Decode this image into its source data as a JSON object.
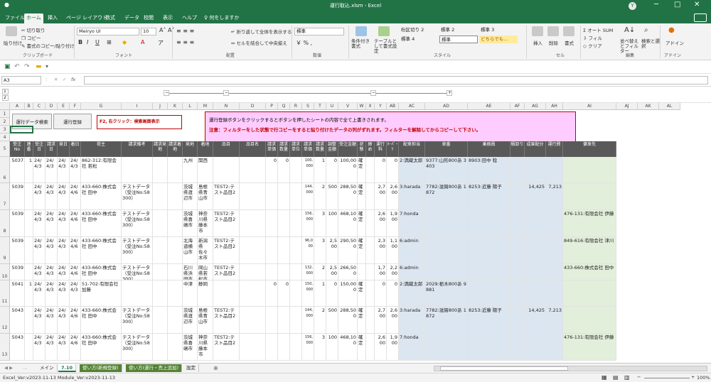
{
  "window": {
    "title": "運行取込.xlsm - Excel",
    "user_initial": "Y",
    "min": "─",
    "max": "□",
    "close": "✕"
  },
  "ribbon_tabs": [
    "ファイル",
    "ホーム",
    "挿入",
    "ページ レイアウト",
    "数式",
    "データ",
    "校閲",
    "表示",
    "ヘルプ",
    "何をしますか"
  ],
  "ribbon": {
    "paste": "貼り付け",
    "cut": "切り取り",
    "copy": "コピー",
    "format_painter": "書式のコピー/貼り付け",
    "clipboard_group": "クリップボード",
    "font_name": "Meiryo UI",
    "font_size": "10",
    "font_group": "フォント",
    "wrap_text": "折り返して全体を表示する",
    "merge_center": "セルを結合して中央揃え",
    "align_group": "配置",
    "number_format": "標準",
    "number_group": "数値",
    "cond_format": "条件付き書式",
    "table_format": "テーブルとして書式設定",
    "styles": [
      "桁区切り 2",
      "標準 2",
      "標準 3",
      "標準 4",
      "標準",
      "どちらでも..."
    ],
    "style_group": "スタイル",
    "insert": "挿入",
    "delete": "削除",
    "format": "書式",
    "cells_group": "セル",
    "autosum": "オート SUM",
    "fill": "フィル",
    "clear": "クリア",
    "sort_filter": "並べ替えとフィルター",
    "find_select": "検索と選択",
    "edit_group": "編集",
    "addin": "アドイン",
    "addin_group": "アドイン"
  },
  "formula_bar": {
    "name_box": "A3",
    "fx": "fx",
    "content": ""
  },
  "outline": {
    "levels": [
      "1",
      "2"
    ],
    "minus": "−",
    "plus": "+"
  },
  "columns": [
    "A",
    "B",
    "C",
    "D",
    "E",
    "F",
    "G",
    "I",
    "J",
    "K",
    "L",
    "M",
    "N",
    "O",
    "P",
    "Q",
    "R",
    "S",
    "T",
    "U",
    "V",
    "W",
    "X",
    "Y",
    "AB",
    "AC",
    "AD",
    "AE",
    "AF",
    "AG",
    "AH",
    "AI",
    "AJ",
    "AK",
    "AL"
  ],
  "rows": [
    "1",
    "2",
    "3",
    "4",
    "5",
    "6",
    "7",
    "8",
    "9",
    "10",
    "11",
    "12",
    "13"
  ],
  "top": {
    "btn_import": "運行データ検索",
    "btn_register": "運行登録",
    "hint_f2": "F2, 右クリック：検索画面表示",
    "note1": "運行登録ボタンをクリックするとボタンを押したシートの内容で全て上書きされます。",
    "note2": "注意：フィルターをした状態で行コピーをすると貼り付けたデータの列がずれます。フィルターを解除してからコピーして下さい。"
  },
  "headers": [
    "受注No",
    "連番",
    "受注日",
    "請求日",
    "発日",
    "着日",
    "荷主",
    "請求備考",
    "請求発地",
    "請求着地",
    "発地",
    "着地",
    "品目",
    "品目名",
    "請求単価",
    "請求数量",
    "請求単位",
    "請求単価",
    "請求数量",
    "調整金額",
    "受注金額",
    "状態",
    "締め",
    "運行料",
    "ｷｰﾊﾟｰﾂ",
    "配車担当",
    "車番",
    "乗務員",
    "積卸り",
    "成果配分",
    "運行費",
    "傭車先"
  ],
  "table_rows": [
    {
      "no": "5037",
      "ren": "1",
      "ju": "24/4/3",
      "sei": "24/4/3",
      "hatsu": "24/4/3",
      "chaku": "24/4/3",
      "ninushi": "862-312:有限会社 若松",
      "biko": "",
      "hatchi": "九州",
      "chakuchi": "関西",
      "hinmoku": "",
      "hinmei": "",
      "tan": "0",
      "su": "0",
      "tanka2": "100,000",
      "su2": "1",
      "cho": "0",
      "kin": "100,000",
      "jo": "確定",
      "shime": "",
      "ryo": "0",
      "kp": "0",
      "tanto": "2:満蔵太郎",
      "sha": "9377:山形800あ 3403",
      "jomu": "8903:田中 稔",
      "tsumi": "",
      "seika": "",
      "unko": "",
      "yosha": ""
    },
    {
      "no": "5039",
      "ren": "",
      "ju": "24/4/3",
      "sei": "24/4/3",
      "hatsu": "24/4/3",
      "chaku": "24/4/6",
      "ninushi": "433-660:株式会社 田中",
      "biko": "テストデータ（受注No:58300）",
      "hatchi": "茨城県渡辺市",
      "chakuchi": "島根県青山市",
      "hinmoku": "TEST2:テスト品目2",
      "hinmei": "",
      "tan": "",
      "su": "",
      "tanka2": "144,000",
      "su2": "2",
      "cho": "500",
      "kin": "288,500",
      "jo": "確定",
      "shime": "",
      "ryo": "2,700",
      "kp": "2,600",
      "tanto": "3:harada",
      "sha": "7782:滋賀800あ 1872",
      "jomu": "8253:近藤 陽子",
      "tsumi": "",
      "seika": "14,425",
      "unko": "7,213",
      "yosha": ""
    },
    {
      "no": "5039",
      "ren": "",
      "ju": "24/4/3",
      "sei": "24/4/3",
      "hatsu": "24/4/3",
      "chaku": "24/4/6",
      "ninushi": "433-660:株式会社 田中",
      "biko": "テストデータ（受注No:58300）",
      "hatchi": "茨城県喜嶋市",
      "chakuchi": "神奈川県藤本市",
      "hinmoku": "TEST2:テスト品目2",
      "hinmei": "",
      "tan": "",
      "su": "",
      "tanka2": "156,000",
      "su2": "3",
      "cho": "100",
      "kin": "468,100",
      "jo": "確定",
      "shime": "",
      "ryo": "2,600",
      "kp": "1,900",
      "tanto": "7:honda",
      "sha": "",
      "jomu": "",
      "tsumi": "",
      "seika": "",
      "unko": "",
      "yosha": "476-131:有限会社 伊藤"
    },
    {
      "no": "5039",
      "ren": "",
      "ju": "24/4/3",
      "sei": "24/4/3",
      "hatsu": "24/4/3",
      "chaku": "24/4/6",
      "ninushi": "433-660:株式会社 田中",
      "biko": "テストデータ（受注No:58300）",
      "hatchi": "北海道横山市",
      "chakuchi": "新潟県佐々木市",
      "hinmoku": "TEST2:テスト品目2",
      "hinmei": "",
      "tan": "",
      "su": "",
      "tanka2": "96,000",
      "su2": "3",
      "cho": "2,500",
      "kin": "290,500",
      "jo": "確定",
      "shime": "",
      "ryo": "2,300",
      "kp": "1,100",
      "tanto": "6:admin",
      "sha": "",
      "jomu": "",
      "tsumi": "",
      "seika": "",
      "unko": "",
      "yosha": "849-616:有限会社 津川"
    },
    {
      "no": "5039",
      "ren": "",
      "ju": "24/4/3",
      "sei": "24/4/3",
      "hatsu": "24/4/3",
      "chaku": "24/4/6",
      "ninushi": "433-660:株式会社 田中",
      "biko": "テストデータ（受注No:58300）",
      "hatchi": "石川県浜田市",
      "chakuchi": "岡山県若松市",
      "hinmoku": "TEST2:テスト品目2",
      "hinmei": "",
      "tan": "",
      "su": "",
      "tanka2": "132,000",
      "su2": "2",
      "cho": "2,500",
      "kin": "266,500",
      "jo": "",
      "shime": "",
      "ryo": "1,700",
      "kp": "2,200",
      "tanto": "6:admin",
      "sha": "",
      "jomu": "",
      "tsumi": "",
      "seika": "",
      "unko": "",
      "yosha": "433-660:株式会社 田中"
    },
    {
      "no": "5041",
      "ren": "1",
      "ju": "24/4/3",
      "sei": "24/4/3",
      "hatsu": "24/4/3",
      "chaku": "24/4/3",
      "ninushi": "51-702:有限会社 加藤",
      "biko": "",
      "hatchi": "中津",
      "chakuchi": "静岡",
      "hinmoku": "",
      "hinmei": "",
      "tan": "0",
      "su": "0",
      "tanka2": "150,000",
      "su2": "1",
      "cho": "0",
      "kin": "150,000",
      "jo": "確定",
      "shime": "",
      "ryo": "0",
      "kp": "0",
      "tanto": "2:満蔵太郎",
      "sha": "2029:栃木800あ 9881",
      "jomu": "",
      "tsumi": "",
      "seika": "",
      "unko": "",
      "yosha": ""
    },
    {
      "no": "5043",
      "ren": "",
      "ju": "24/4/3",
      "sei": "24/4/3",
      "hatsu": "24/4/3",
      "chaku": "24/4/6",
      "ninushi": "433-660:株式会社 田中",
      "biko": "テストデータ（受注No:58300）",
      "hatchi": "茨城県渡辺市",
      "chakuchi": "島根県青山市",
      "hinmoku": "TEST2:テスト品目2",
      "hinmei": "",
      "tan": "",
      "su": "",
      "tanka2": "144,000",
      "su2": "2",
      "cho": "500",
      "kin": "288,500",
      "jo": "確定",
      "shime": "",
      "ryo": "2,700",
      "kp": "2,600",
      "tanto": "3:harada",
      "sha": "7782:滋賀800あ 1872",
      "jomu": "8253:近藤 陽子",
      "tsumi": "",
      "seika": "14,425",
      "unko": "7,213",
      "yosha": ""
    },
    {
      "no": "5043",
      "ren": "",
      "ju": "24/4/3",
      "sei": "24/4/3",
      "hatsu": "24/4/3",
      "chaku": "24/4/6",
      "ninushi": "433-660:株式会社 田中",
      "biko": "テストデータ（受注No:58300）",
      "hatchi": "茨城県喜嶋市",
      "chakuchi": "神奈川県藤本市",
      "hinmoku": "TEST2:テスト品目2",
      "hinmei": "",
      "tan": "",
      "su": "",
      "tanka2": "156,000",
      "su2": "3",
      "cho": "100",
      "kin": "468,100",
      "jo": "確定",
      "shime": "",
      "ryo": "2,600",
      "kp": "1,900",
      "tanto": "7:honda",
      "sha": "",
      "jomu": "",
      "tsumi": "",
      "seika": "",
      "unko": "",
      "yosha": "476-131:有限会社 伊藤"
    }
  ],
  "sheet_tabs": [
    "メイン",
    "7.10",
    "使い方(新規登録)",
    "使い方(運行・売上追加)",
    "設定"
  ],
  "status": {
    "left": "Excel_Ver:v2023-11-13 Module_Ver:v2023-11-13",
    "zoom": "100%"
  },
  "colors": {
    "excel_green": "#217346",
    "header_dark": "#595959",
    "blue_fill": "#dce6f1",
    "green_fill": "#e2efda",
    "note_pink": "#ffccff",
    "note_red": "#c00000"
  }
}
